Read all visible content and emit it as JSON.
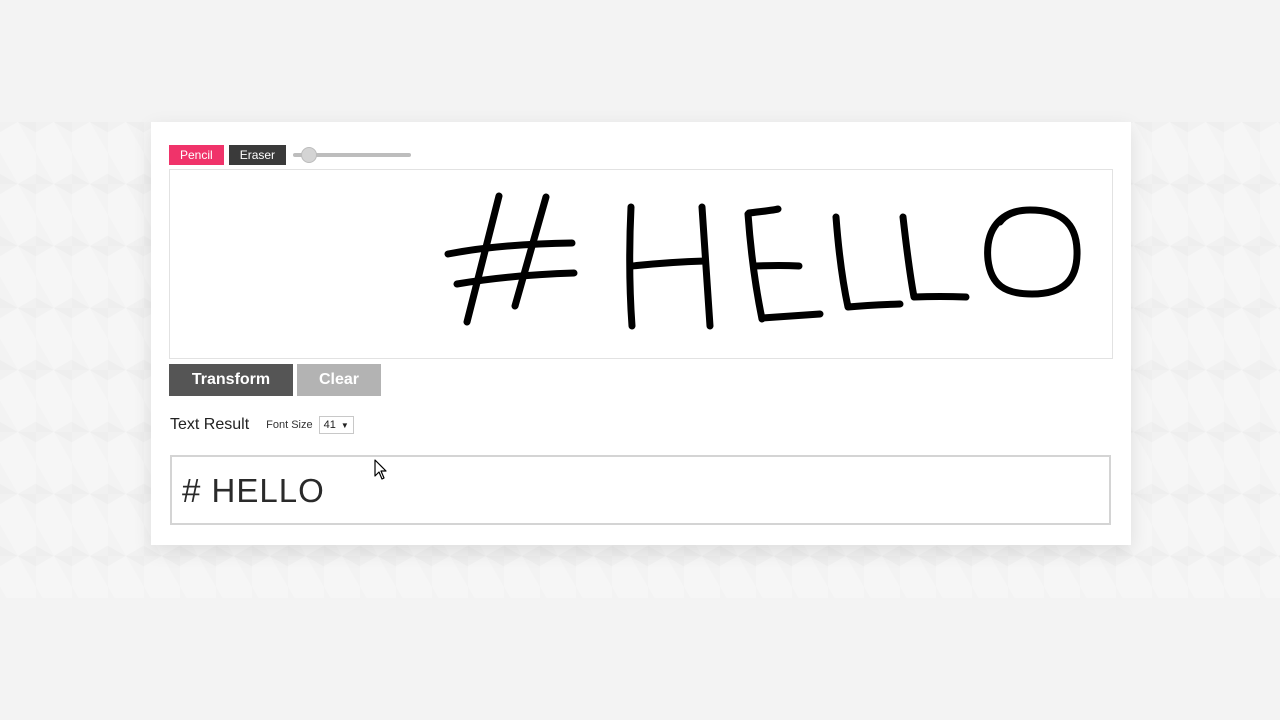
{
  "toolbar": {
    "pencil_label": "Pencil",
    "eraser_label": "Eraser",
    "brush_size": 0.1
  },
  "canvas": {
    "drawn_text": "# HELLO"
  },
  "actions": {
    "transform_label": "Transform",
    "clear_label": "Clear"
  },
  "result": {
    "title": "Text Result",
    "font_size_label": "Font Size",
    "font_size_value": "41",
    "text": "# HELLO"
  },
  "icons": {
    "caret": "caret-down-icon",
    "pointer": "mouse-pointer-icon"
  },
  "colors": {
    "pencil": "#f0336a",
    "eraser": "#3a3a3a",
    "transform": "#555555",
    "clear": "#b3b3b3"
  }
}
